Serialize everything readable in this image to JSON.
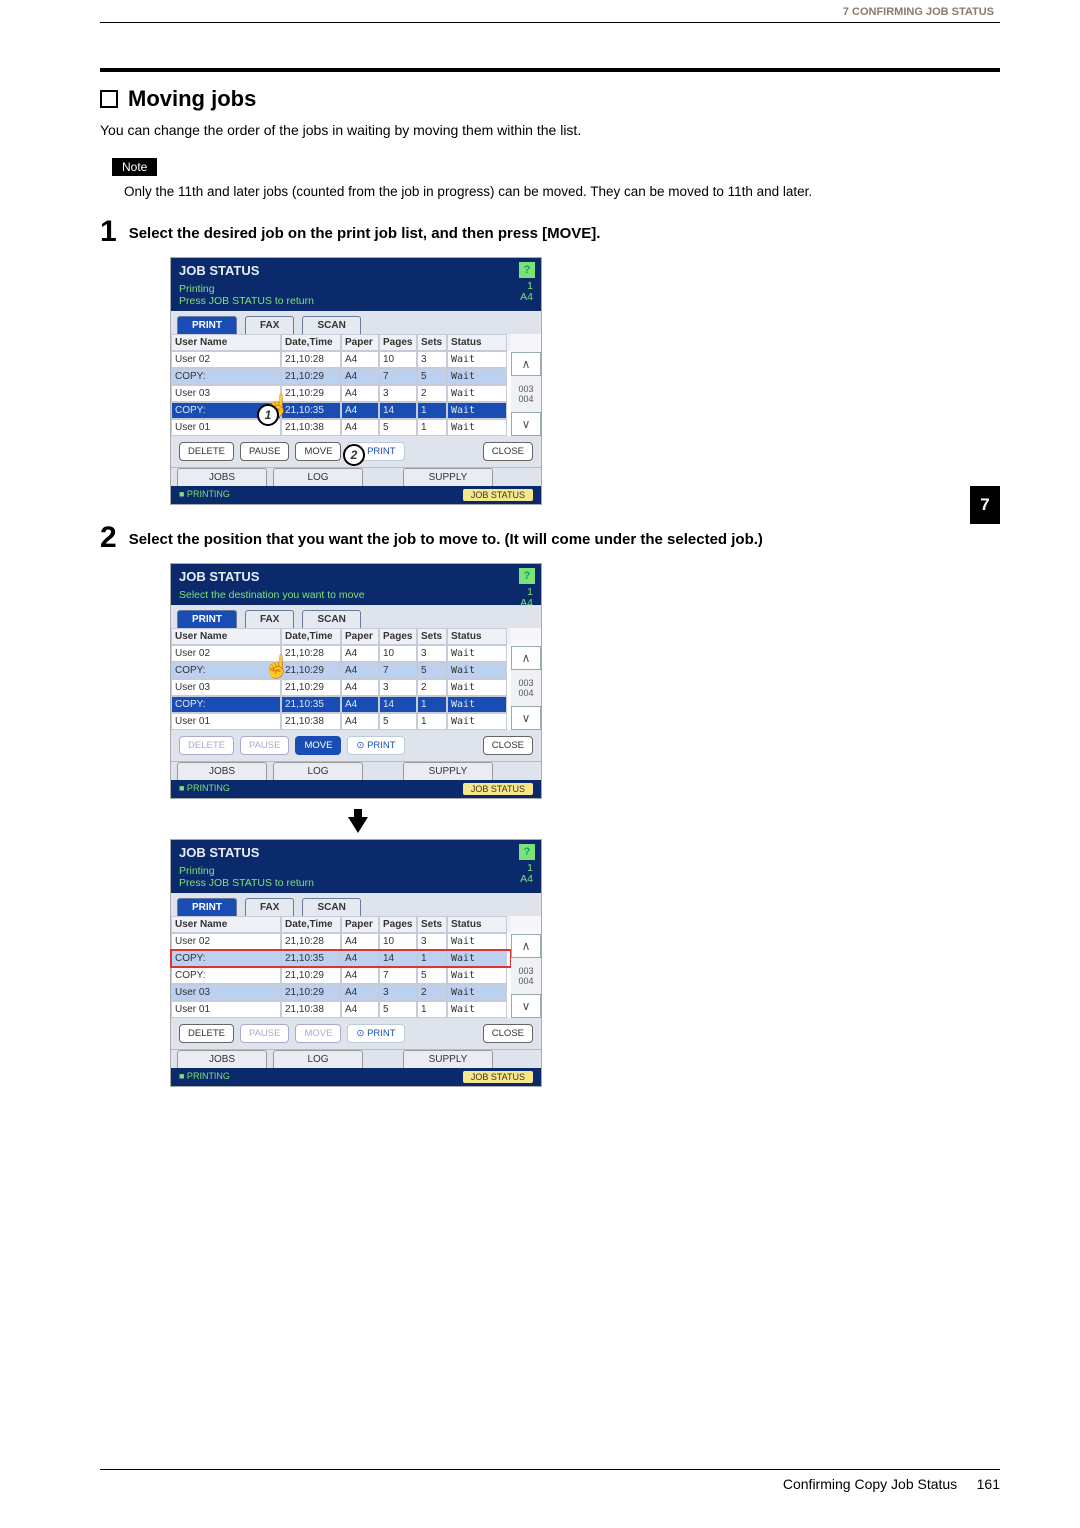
{
  "header_text": "7 CONFIRMING JOB STATUS",
  "side_tab": "7",
  "section_title": "Moving jobs",
  "intro": "You can change the order of the jobs in waiting by moving them within the list.",
  "note_label": "Note",
  "note_text": "Only the 11th and later jobs (counted from the job in progress) can be moved. They can be moved to 11th and later.",
  "step1_num": "1",
  "step1_text": "Select the desired job on the print job list, and then press [MOVE].",
  "step2_num": "2",
  "step2_text": "Select the position that you want the job to move to. (It will come under the selected job.)",
  "footer_left": "Confirming Copy Job Status",
  "footer_page": "161",
  "common": {
    "title": "JOB STATUS",
    "help_q": "?",
    "count1": "1",
    "countA4": "A4",
    "tabs": {
      "print": "PRINT",
      "fax": "FAX",
      "scan": "SCAN"
    },
    "cols": {
      "user": "User Name",
      "dt": "Date,Time",
      "paper": "Paper",
      "pages": "Pages",
      "sets": "Sets",
      "status": "Status"
    },
    "buttons": {
      "delete": "DELETE",
      "pause": "PAUSE",
      "move": "MOVE",
      "print": "PRINT",
      "close": "CLOSE"
    },
    "sectabs": {
      "jobs": "JOBS",
      "log": "LOG",
      "supply": "SUPPLY"
    },
    "footbar_left": "■ PRINTING",
    "footbar_btn": "JOB STATUS",
    "scroll_pages": "003\n004",
    "scroll_mid2": "003\n004"
  },
  "shot1": {
    "subline": "Printing",
    "subline2": "Press JOB STATUS to return",
    "rows": [
      {
        "user": "User 02",
        "dt": "21,10:28",
        "paper": "A4",
        "pages": "10",
        "sets": "3",
        "status": "Wait",
        "sel": false
      },
      {
        "user": "COPY:",
        "dt": "21,10:29",
        "paper": "A4",
        "pages": "7",
        "sets": "5",
        "status": "Wait",
        "sel": false,
        "alt": true
      },
      {
        "user": "User 03",
        "dt": "21,10:29",
        "paper": "A4",
        "pages": "3",
        "sets": "2",
        "status": "Wait",
        "sel": false
      },
      {
        "user": "COPY:",
        "dt": "21,10:35",
        "paper": "A4",
        "pages": "14",
        "sets": "1",
        "status": "Wait",
        "sel": true
      },
      {
        "user": "User 01",
        "dt": "21,10:38",
        "paper": "A4",
        "pages": "5",
        "sets": "1",
        "status": "Wait",
        "sel": false
      }
    ],
    "circles": {
      "c1": "1",
      "c2": "2"
    }
  },
  "shot2": {
    "subline": "Select the destination you want to move",
    "rows": [
      {
        "user": "User 02",
        "dt": "21,10:28",
        "paper": "A4",
        "pages": "10",
        "sets": "3",
        "status": "Wait",
        "sel": false
      },
      {
        "user": "COPY:",
        "dt": "21,10:29",
        "paper": "A4",
        "pages": "7",
        "sets": "5",
        "status": "Wait",
        "sel": false,
        "alt": true
      },
      {
        "user": "User 03",
        "dt": "21,10:29",
        "paper": "A4",
        "pages": "3",
        "sets": "2",
        "status": "Wait",
        "sel": false
      },
      {
        "user": "COPY:",
        "dt": "21,10:35",
        "paper": "A4",
        "pages": "14",
        "sets": "1",
        "status": "Wait",
        "sel": true
      },
      {
        "user": "User 01",
        "dt": "21,10:38",
        "paper": "A4",
        "pages": "5",
        "sets": "1",
        "status": "Wait",
        "sel": false
      }
    ]
  },
  "shot3": {
    "subline": "Printing",
    "subline2": "Press JOB STATUS to return",
    "rows": [
      {
        "user": "User 02",
        "dt": "21,10:28",
        "paper": "A4",
        "pages": "10",
        "sets": "3",
        "status": "Wait",
        "sel": false
      },
      {
        "user": "COPY:",
        "dt": "21,10:35",
        "paper": "A4",
        "pages": "14",
        "sets": "1",
        "status": "Wait",
        "sel": false,
        "alt": true,
        "red": true
      },
      {
        "user": "COPY:",
        "dt": "21,10:29",
        "paper": "A4",
        "pages": "7",
        "sets": "5",
        "status": "Wait",
        "sel": false
      },
      {
        "user": "User 03",
        "dt": "21,10:29",
        "paper": "A4",
        "pages": "3",
        "sets": "2",
        "status": "Wait",
        "sel": false,
        "alt": true
      },
      {
        "user": "User 01",
        "dt": "21,10:38",
        "paper": "A4",
        "pages": "5",
        "sets": "1",
        "status": "Wait",
        "sel": false
      }
    ]
  }
}
